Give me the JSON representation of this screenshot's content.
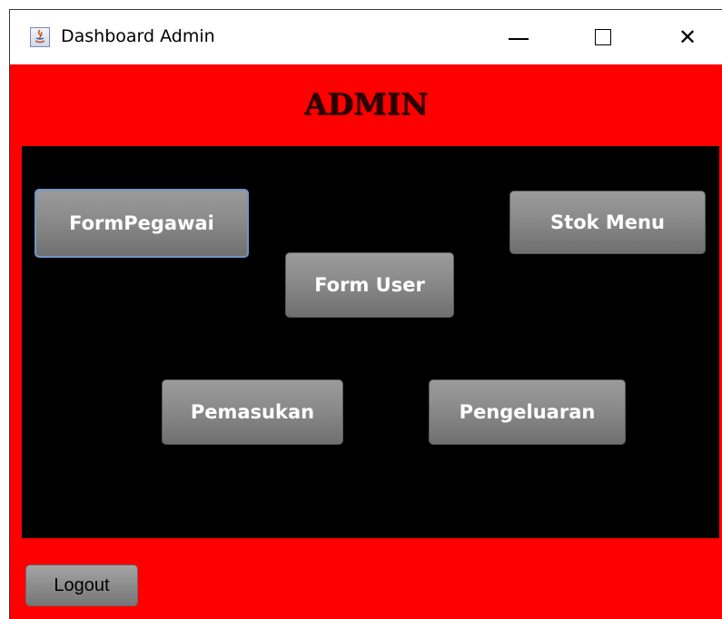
{
  "window": {
    "title": "Dashboard Admin",
    "controls": {
      "minimize": "minimize-icon",
      "maximize": "maximize-icon",
      "close": "close-icon",
      "close_glyph": "✕"
    }
  },
  "header": {
    "title": "ADMIN"
  },
  "menu": {
    "form_pegawai": "FormPegawai",
    "stok_menu": "Stok Menu",
    "form_user": "Form User",
    "pemasukan": "Pemasukan",
    "pengeluaran": "Pengeluaran"
  },
  "footer": {
    "logout": "Logout"
  },
  "colors": {
    "panel_background": "#ff0000",
    "menu_background": "#000000",
    "button_text": "#ffffff",
    "focus_border": "#6f95c8"
  }
}
